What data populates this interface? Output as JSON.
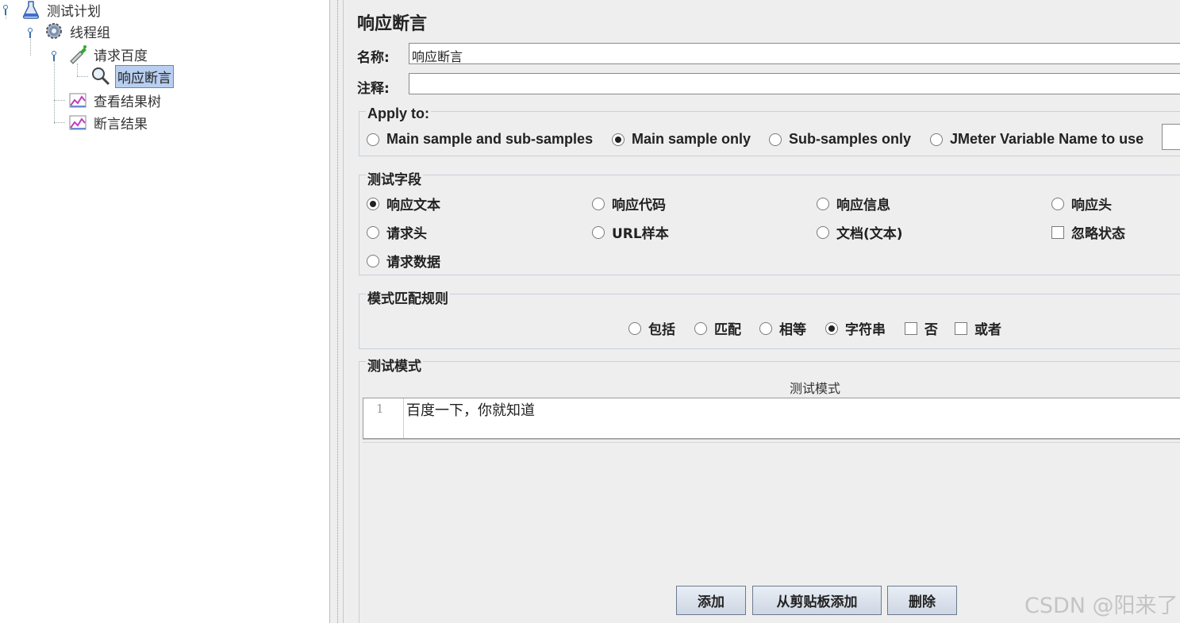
{
  "tree": {
    "nodes": [
      {
        "label": "测试计划",
        "icon": "test-plan-flask-icon"
      },
      {
        "label": "线程组",
        "icon": "thread-group-gear-icon"
      },
      {
        "label": "请求百度",
        "icon": "http-request-pipette-icon"
      },
      {
        "label": "响应断言",
        "icon": "assertion-magnifier-icon",
        "selected": true
      },
      {
        "label": "查看结果树",
        "icon": "listener-chart-icon"
      },
      {
        "label": "断言结果",
        "icon": "listener-chart-icon"
      }
    ]
  },
  "panel": {
    "title": "响应断言",
    "name_label": "名称:",
    "name_value": "响应断言",
    "comment_label": "注释:",
    "comment_value": ""
  },
  "apply_to": {
    "title": "Apply to:",
    "options": [
      {
        "label": "Main sample and sub-samples",
        "selected": false
      },
      {
        "label": "Main sample only",
        "selected": true
      },
      {
        "label": "Sub-samples only",
        "selected": false
      },
      {
        "label": "JMeter Variable Name to use",
        "selected": false
      }
    ],
    "variable_value": ""
  },
  "test_field": {
    "title": "测试字段",
    "options": [
      {
        "label": "响应文本",
        "type": "radio",
        "selected": true
      },
      {
        "label": "响应代码",
        "type": "radio",
        "selected": false
      },
      {
        "label": "响应信息",
        "type": "radio",
        "selected": false
      },
      {
        "label": "响应头",
        "type": "radio",
        "selected": false
      },
      {
        "label": "请求头",
        "type": "radio",
        "selected": false
      },
      {
        "label": "URL样本",
        "type": "radio",
        "selected": false
      },
      {
        "label": "文档(文本)",
        "type": "radio",
        "selected": false
      },
      {
        "label": "忽略状态",
        "type": "checkbox",
        "selected": false
      },
      {
        "label": "请求数据",
        "type": "radio",
        "selected": false
      }
    ]
  },
  "match_rules": {
    "title": "模式匹配规则",
    "options": [
      {
        "label": "包括",
        "type": "radio",
        "selected": false
      },
      {
        "label": "匹配",
        "type": "radio",
        "selected": false
      },
      {
        "label": "相等",
        "type": "radio",
        "selected": false
      },
      {
        "label": "字符串",
        "type": "radio",
        "selected": true
      },
      {
        "label": "否",
        "type": "checkbox",
        "selected": false
      },
      {
        "label": "或者",
        "type": "checkbox",
        "selected": false
      }
    ]
  },
  "patterns": {
    "title": "测试模式",
    "column_header": "测试模式",
    "rows": [
      {
        "line": "1",
        "text": "百度一下，你就知道"
      }
    ]
  },
  "buttons": {
    "add": "添加",
    "add_clipboard": "从剪贴板添加",
    "delete": "删除"
  },
  "watermark": "CSDN @阳来了"
}
